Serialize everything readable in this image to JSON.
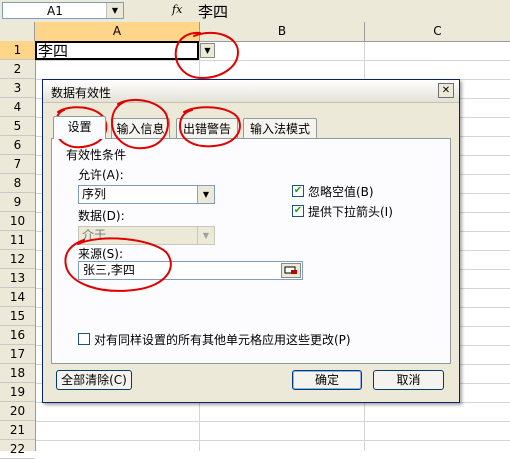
{
  "formula_bar": {
    "name_box": "A1",
    "fx_label": "fx",
    "value": "李四"
  },
  "columns": [
    "A",
    "B",
    "C"
  ],
  "rows": [
    "1",
    "2",
    "3",
    "4",
    "5",
    "6",
    "7",
    "8",
    "9",
    "10",
    "11",
    "12",
    "13",
    "14",
    "15",
    "16",
    "17",
    "18",
    "19",
    "20",
    "21",
    "22"
  ],
  "cell_a1": "李四",
  "dialog": {
    "title": "数据有效性",
    "tabs": [
      "设置",
      "输入信息",
      "出错警告",
      "输入法模式"
    ],
    "active_tab": "设置",
    "group_title": "有效性条件",
    "allow_label": "允许(A):",
    "allow_value": "序列",
    "data_label": "数据(D):",
    "data_value": "介于",
    "ignore_blank": "忽略空值(B)",
    "dropdown_arrow": "提供下拉箭头(I)",
    "source_label": "来源(S):",
    "source_value": "张三,李四",
    "apply_all": "对有同样设置的所有其他单元格应用这些更改(P)",
    "clear_all": "全部清除(C)",
    "ok": "确定",
    "cancel": "取消"
  },
  "colors": {
    "annotation": "#e00000",
    "selection_header": "#ffd58a",
    "dialog_bg": "#ece9d8"
  }
}
